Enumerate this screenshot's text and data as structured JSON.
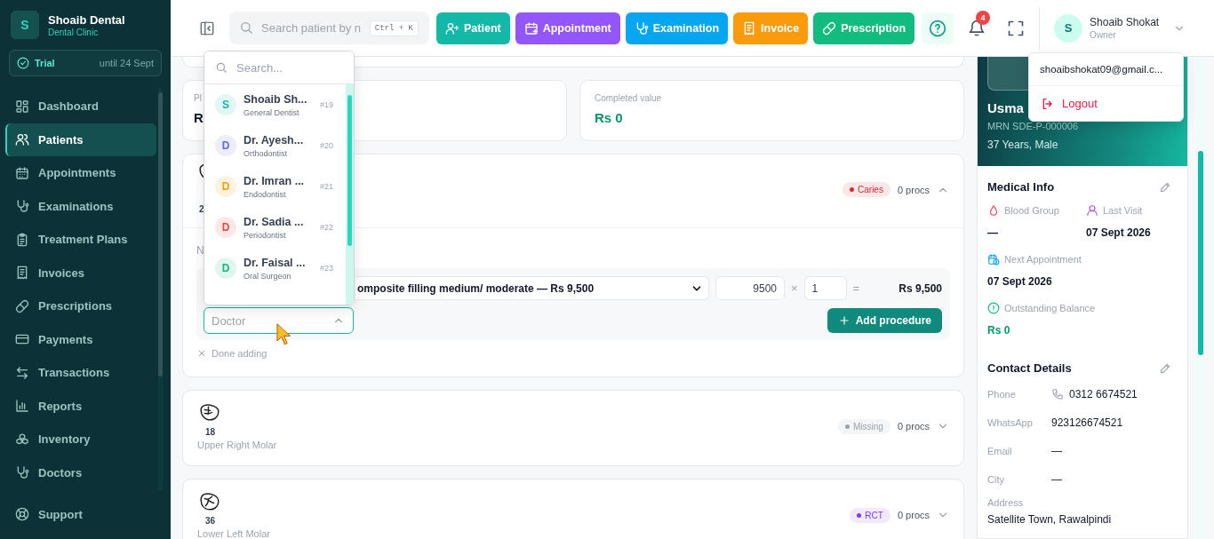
{
  "sidebar": {
    "brand": {
      "initial": "S",
      "name": "Shoaib Dental",
      "subtitle": "Dental Clinic"
    },
    "trial": {
      "label": "Trial",
      "until": "until 24 Sept"
    },
    "items": [
      {
        "label": "Dashboard",
        "selected": false
      },
      {
        "label": "Patients",
        "selected": true
      },
      {
        "label": "Appointments",
        "selected": false
      },
      {
        "label": "Examinations",
        "selected": false
      },
      {
        "label": "Treatment Plans",
        "selected": false
      },
      {
        "label": "Invoices",
        "selected": false
      },
      {
        "label": "Prescriptions",
        "selected": false
      },
      {
        "label": "Payments",
        "selected": false
      },
      {
        "label": "Transactions",
        "selected": false
      },
      {
        "label": "Reports",
        "selected": false
      },
      {
        "label": "Inventory",
        "selected": false
      },
      {
        "label": "Doctors",
        "selected": false
      }
    ],
    "support": "Support"
  },
  "topbar": {
    "search": {
      "placeholder": "Search patient by n",
      "shortcut": "Ctrl + K"
    },
    "actions": [
      {
        "label": "Patient",
        "color": "#14b8a6"
      },
      {
        "label": "Appointment",
        "color": "#9356fb"
      },
      {
        "label": "Examination",
        "color": "#06a7f0"
      },
      {
        "label": "Invoice",
        "color": "#fb9b0b"
      },
      {
        "label": "Prescription",
        "color": "#12bb80"
      }
    ],
    "notifications": "4",
    "user": {
      "initial": "S",
      "name": "Shoaib Shokat",
      "role": "Owner"
    }
  },
  "stats": [
    {
      "label": "Pl",
      "value": "R",
      "kind": "plain"
    },
    {
      "label": "Completed value",
      "value": "Rs 0",
      "kind": "money"
    }
  ],
  "teeth": [
    {
      "number": "2",
      "status": "Caries",
      "color": "#dc2626",
      "procs": "0 procs",
      "expanded": true,
      "editor": {
        "note": "N",
        "procedure": "omposite filling medium/ moderate — Rs 9,500",
        "price": "9500",
        "times": "×",
        "qty": "1",
        "equals": "=",
        "total": "Rs 9,500",
        "doctor": {
          "placeholder": "Doctor",
          "open": true
        },
        "add_button": "Add procedure",
        "done": "Done adding"
      }
    },
    {
      "number": "18",
      "name": "Upper Right Molar",
      "status": "Missing",
      "color": "#9ca3af",
      "procs": "0 procs",
      "expanded": false
    },
    {
      "number": "36",
      "name": "Lower Left Molar",
      "status": "RCT",
      "color": "#7c3aed",
      "procs": "0 procs",
      "expanded": false
    }
  ],
  "doctor_dropdown": {
    "search_placeholder": "Search...",
    "items": [
      {
        "initial": "S",
        "name": "Shoaib Sh...",
        "role": "General Dentist",
        "number": "#19",
        "color": "#14b8a6"
      },
      {
        "initial": "D",
        "name": "Dr. Ayesh...",
        "role": "Orthodontist",
        "number": "#20",
        "color": "#6366f1"
      },
      {
        "initial": "D",
        "name": "Dr. Imran ...",
        "role": "Endodontist",
        "number": "#21",
        "color": "#f59e0b"
      },
      {
        "initial": "D",
        "name": "Dr. Sadia ...",
        "role": "Periodontist",
        "number": "#22",
        "color": "#ef4444"
      },
      {
        "initial": "D",
        "name": "Dr. Faisal ...",
        "role": "Oral Surgeon",
        "number": "#23",
        "color": "#10b981"
      }
    ]
  },
  "patient": {
    "name": "Usma",
    "mrn": "MRN SDE-P-000006",
    "age": "37 Years, Male",
    "medical": {
      "title": "Medical Info",
      "fields": [
        {
          "label": "Blood Group",
          "value": "—",
          "kind": "plain"
        },
        {
          "label": "Last Visit",
          "value": "07 Sept 2026",
          "kind": "plain"
        },
        {
          "label": "Next Appointment",
          "value": "07 Sept 2026",
          "kind": "plain"
        },
        {
          "label": "Outstanding Balance",
          "value": "Rs 0",
          "kind": "money"
        }
      ]
    },
    "contact": {
      "title": "Contact Details",
      "fields": [
        {
          "label": "Phone",
          "value": "0312 6674521",
          "kind": "phone"
        },
        {
          "label": "WhatsApp",
          "value": "923126674521",
          "kind": "inline"
        },
        {
          "label": "Email",
          "value": "—",
          "kind": "inline"
        },
        {
          "label": "City",
          "value": "—",
          "kind": "inline"
        },
        {
          "label": "Address",
          "value": "Satellite Town, Rawalpindi",
          "kind": "stacked"
        }
      ]
    }
  },
  "user_menu": {
    "email": "shoaibshokat09@gmail.c...",
    "logout": "Logout"
  }
}
